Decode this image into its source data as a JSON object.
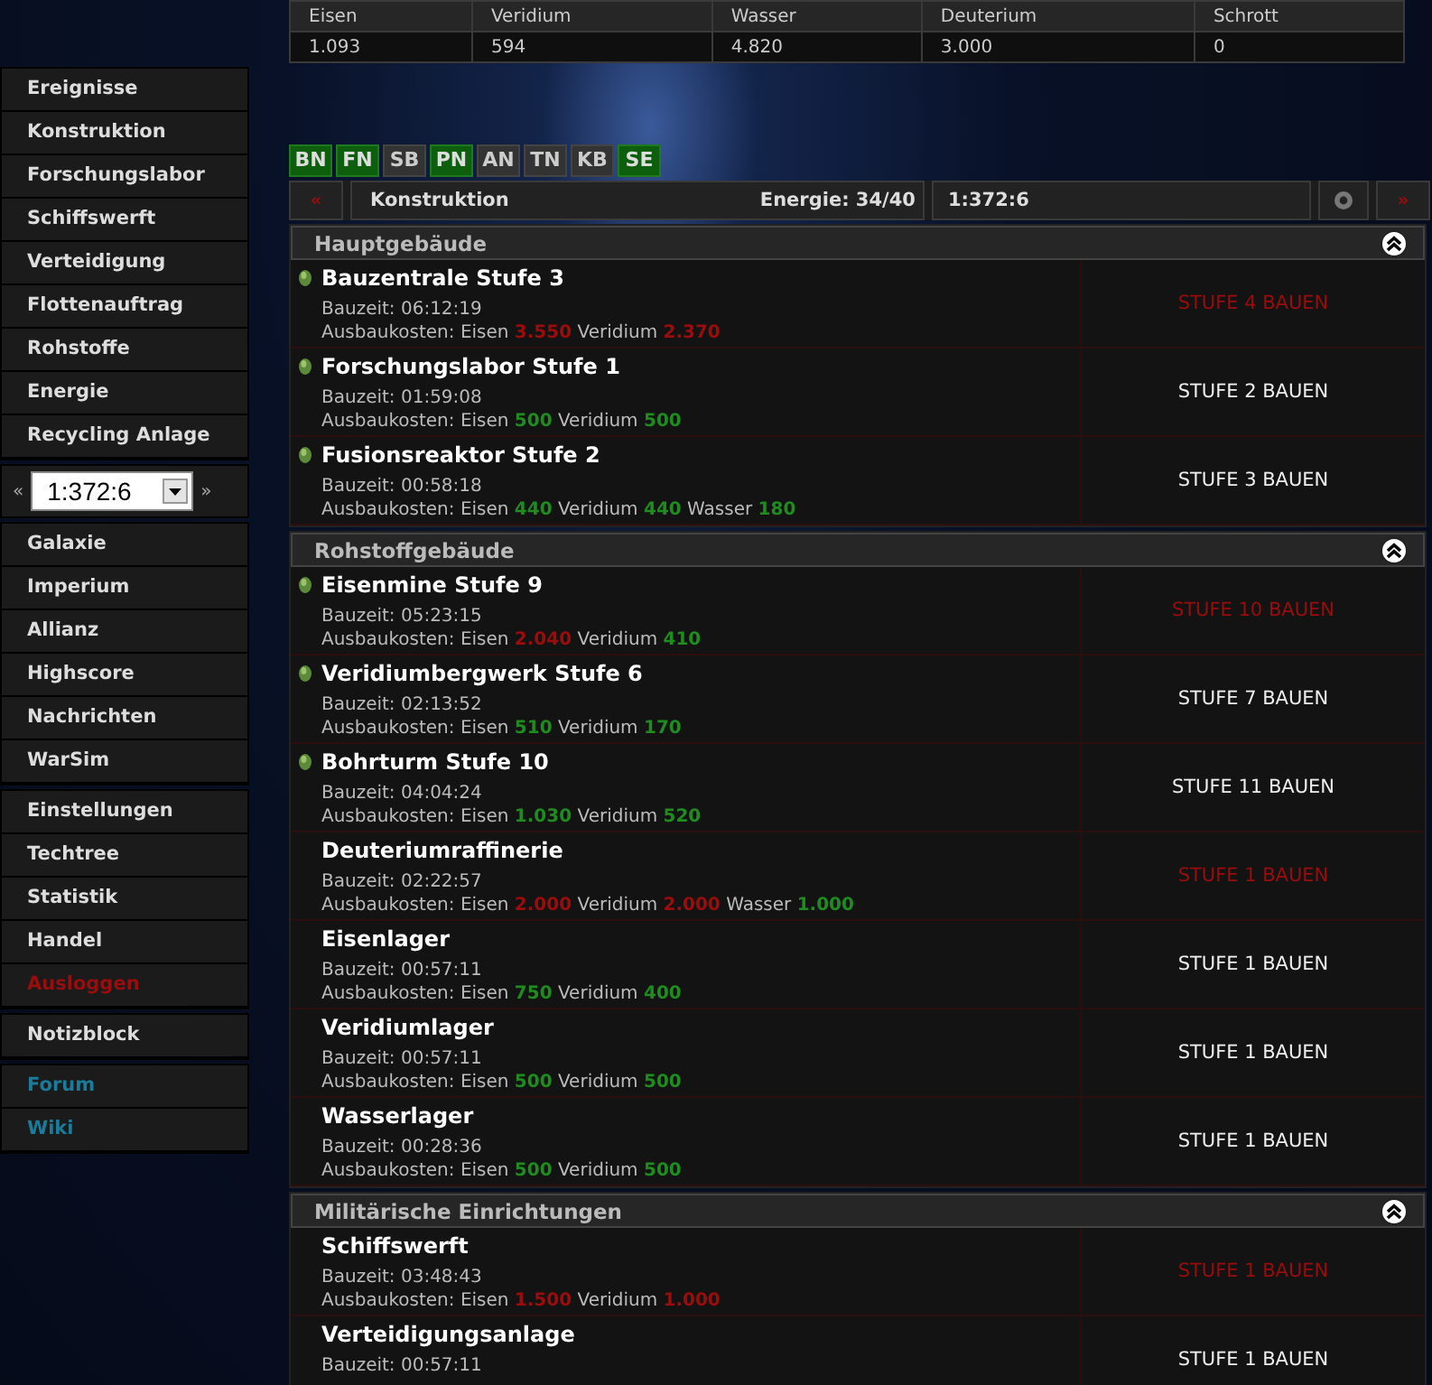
{
  "resources": {
    "columns": [
      "Eisen",
      "Veridium",
      "Wasser",
      "Deuterium",
      "Schrott"
    ],
    "values": [
      "1.093",
      "594",
      "4.820",
      "3.000",
      "0"
    ]
  },
  "sidebar": {
    "groups": [
      {
        "items": [
          {
            "label": "Ereignisse",
            "kind": "normal"
          },
          {
            "label": "Konstruktion",
            "kind": "normal"
          },
          {
            "label": "Forschungslabor",
            "kind": "normal"
          },
          {
            "label": "Schiffswerft",
            "kind": "normal"
          },
          {
            "label": "Verteidigung",
            "kind": "normal"
          },
          {
            "label": "Flottenauftrag",
            "kind": "normal"
          },
          {
            "label": "Rohstoffe",
            "kind": "normal"
          },
          {
            "label": "Energie",
            "kind": "normal"
          },
          {
            "label": "Recycling Anlage",
            "kind": "normal"
          }
        ]
      },
      {
        "planet_selector": {
          "prev": "«",
          "value": "1:372:6",
          "next": "»"
        }
      },
      {
        "items": [
          {
            "label": "Galaxie",
            "kind": "normal"
          },
          {
            "label": "Imperium",
            "kind": "normal"
          },
          {
            "label": "Allianz",
            "kind": "normal"
          },
          {
            "label": "Highscore",
            "kind": "normal"
          },
          {
            "label": "Nachrichten",
            "kind": "normal"
          },
          {
            "label": "WarSim",
            "kind": "normal"
          }
        ]
      },
      {
        "items": [
          {
            "label": "Einstellungen",
            "kind": "normal"
          },
          {
            "label": "Techtree",
            "kind": "normal"
          },
          {
            "label": "Statistik",
            "kind": "normal"
          },
          {
            "label": "Handel",
            "kind": "normal"
          },
          {
            "label": "Ausloggen",
            "kind": "logout"
          }
        ]
      },
      {
        "items": [
          {
            "label": "Notizblock",
            "kind": "normal"
          }
        ]
      },
      {
        "items": [
          {
            "label": "Forum",
            "kind": "external"
          },
          {
            "label": "Wiki",
            "kind": "external"
          }
        ]
      }
    ]
  },
  "tabs": [
    {
      "label": "BN",
      "active": true
    },
    {
      "label": "FN",
      "active": true
    },
    {
      "label": "SB",
      "active": false
    },
    {
      "label": "PN",
      "active": true
    },
    {
      "label": "AN",
      "active": false
    },
    {
      "label": "TN",
      "active": false
    },
    {
      "label": "KB",
      "active": false
    },
    {
      "label": "SE",
      "active": true
    }
  ],
  "header_bar": {
    "prev": "«",
    "title": "Konstruktion",
    "energy": "Energie: 34/40",
    "coordinates": "1:372:6",
    "next": "»"
  },
  "sections": [
    {
      "title": "Hauptgebäude",
      "buildings": [
        {
          "name": "Bauzentrale Stufe 3",
          "indicator": true,
          "build_time": "Bauzeit: 06:12:19",
          "costs_label": "Ausbaukosten:",
          "costs": [
            {
              "resource": "Eisen",
              "amount": "3.550",
              "affordable": false
            },
            {
              "resource": "Veridium",
              "amount": "2.370",
              "affordable": false
            }
          ],
          "action": "STUFE 4 BAUEN",
          "available": false
        },
        {
          "name": "Forschungslabor Stufe 1",
          "indicator": true,
          "build_time": "Bauzeit: 01:59:08",
          "costs_label": "Ausbaukosten:",
          "costs": [
            {
              "resource": "Eisen",
              "amount": "500",
              "affordable": true
            },
            {
              "resource": "Veridium",
              "amount": "500",
              "affordable": true
            }
          ],
          "action": "STUFE 2 BAUEN",
          "available": true
        },
        {
          "name": "Fusionsreaktor Stufe 2",
          "indicator": true,
          "build_time": "Bauzeit: 00:58:18",
          "costs_label": "Ausbaukosten:",
          "costs": [
            {
              "resource": "Eisen",
              "amount": "440",
              "affordable": true
            },
            {
              "resource": "Veridium",
              "amount": "440",
              "affordable": true
            },
            {
              "resource": "Wasser",
              "amount": "180",
              "affordable": true
            }
          ],
          "action": "STUFE 3 BAUEN",
          "available": true
        }
      ]
    },
    {
      "title": "Rohstoffgebäude",
      "buildings": [
        {
          "name": "Eisenmine Stufe 9",
          "indicator": true,
          "build_time": "Bauzeit: 05:23:15",
          "costs_label": "Ausbaukosten:",
          "costs": [
            {
              "resource": "Eisen",
              "amount": "2.040",
              "affordable": false
            },
            {
              "resource": "Veridium",
              "amount": "410",
              "affordable": true
            }
          ],
          "action": "STUFE 10 BAUEN",
          "available": false
        },
        {
          "name": "Veridiumbergwerk Stufe 6",
          "indicator": true,
          "build_time": "Bauzeit: 02:13:52",
          "costs_label": "Ausbaukosten:",
          "costs": [
            {
              "resource": "Eisen",
              "amount": "510",
              "affordable": true
            },
            {
              "resource": "Veridium",
              "amount": "170",
              "affordable": true
            }
          ],
          "action": "STUFE 7 BAUEN",
          "available": true
        },
        {
          "name": "Bohrturm Stufe 10",
          "indicator": true,
          "build_time": "Bauzeit: 04:04:24",
          "costs_label": "Ausbaukosten:",
          "costs": [
            {
              "resource": "Eisen",
              "amount": "1.030",
              "affordable": true
            },
            {
              "resource": "Veridium",
              "amount": "520",
              "affordable": true
            }
          ],
          "action": "STUFE 11 BAUEN",
          "available": true
        },
        {
          "name": "Deuteriumraffinerie",
          "indicator": false,
          "build_time": "Bauzeit: 02:22:57",
          "costs_label": "Ausbaukosten:",
          "costs": [
            {
              "resource": "Eisen",
              "amount": "2.000",
              "affordable": false
            },
            {
              "resource": "Veridium",
              "amount": "2.000",
              "affordable": false
            },
            {
              "resource": "Wasser",
              "amount": "1.000",
              "affordable": true
            }
          ],
          "action": "STUFE 1 BAUEN",
          "available": false
        },
        {
          "name": "Eisenlager",
          "indicator": false,
          "build_time": "Bauzeit: 00:57:11",
          "costs_label": "Ausbaukosten:",
          "costs": [
            {
              "resource": "Eisen",
              "amount": "750",
              "affordable": true
            },
            {
              "resource": "Veridium",
              "amount": "400",
              "affordable": true
            }
          ],
          "action": "STUFE 1 BAUEN",
          "available": true
        },
        {
          "name": "Veridiumlager",
          "indicator": false,
          "build_time": "Bauzeit: 00:57:11",
          "costs_label": "Ausbaukosten:",
          "costs": [
            {
              "resource": "Eisen",
              "amount": "500",
              "affordable": true
            },
            {
              "resource": "Veridium",
              "amount": "500",
              "affordable": true
            }
          ],
          "action": "STUFE 1 BAUEN",
          "available": true
        },
        {
          "name": "Wasserlager",
          "indicator": false,
          "build_time": "Bauzeit: 00:28:36",
          "costs_label": "Ausbaukosten:",
          "costs": [
            {
              "resource": "Eisen",
              "amount": "500",
              "affordable": true
            },
            {
              "resource": "Veridium",
              "amount": "500",
              "affordable": true
            }
          ],
          "action": "STUFE 1 BAUEN",
          "available": true
        }
      ]
    },
    {
      "title": "Militärische Einrichtungen",
      "buildings": [
        {
          "name": "Schiffswerft",
          "indicator": false,
          "build_time": "Bauzeit: 03:48:43",
          "costs_label": "Ausbaukosten:",
          "costs": [
            {
              "resource": "Eisen",
              "amount": "1.500",
              "affordable": false
            },
            {
              "resource": "Veridium",
              "amount": "1.000",
              "affordable": false
            }
          ],
          "action": "STUFE 1 BAUEN",
          "available": false
        },
        {
          "name": "Verteidigungsanlage",
          "indicator": false,
          "build_time": "Bauzeit: 00:57:11",
          "action": "STUFE 1 BAUEN",
          "available": true
        }
      ]
    }
  ]
}
